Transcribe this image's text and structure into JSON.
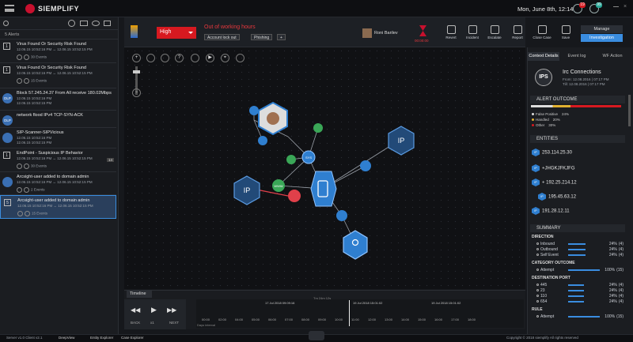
{
  "app": {
    "name": "SIEMPLIFY",
    "date": "Mon, June 8th, 12:14",
    "badge1": "19",
    "badge2": "99"
  },
  "colors": {
    "accent": "#3a8de0",
    "danger": "#d71920",
    "node": "#2f7fd0",
    "green": "#3aa757"
  },
  "left": {
    "alerts_count": "5 Alerts",
    "cases": [
      {
        "num": "1",
        "title": "Virus Found Or Security Risk Found",
        "sub1": "12.06.15 10:52:16 PM ↔ 12.06.15 10:52:15 PM",
        "sub2": "",
        "events": "30 Events"
      },
      {
        "num": "1",
        "title": "Virus Found Or Security Risk Found",
        "sub1": "12.06.15 10:52:16 PM ↔ 12.06.15 10:52:15 PM",
        "sub2": "",
        "events": "15 Events"
      },
      {
        "num": "DLP",
        "title": "Block 57.245.24.37 From All receive 180.02Mbps",
        "sub1": "12.06.15 10:52:16 PM",
        "sub2": "12.06.15 10:52:15 PM",
        "events": ""
      },
      {
        "num": "DLP",
        "title": "network flood IPv4 TCP-SYN-ACK",
        "sub1": "",
        "sub2": "",
        "events": ""
      },
      {
        "num": "",
        "title": "SIP-Scanner-SIPVicious",
        "sub1": "12.06.15 10:52:16 PM",
        "sub2": "12.06.15 10:52:15 PM",
        "events": ""
      },
      {
        "num": "1",
        "title": "EndPoint - Suspicious IP Behavior",
        "sub1": "12.06.15 10:52:16 PM ↔ 12.06.15 10:52:15 PM",
        "sub2": "",
        "events": "30 Events",
        "count": "14"
      },
      {
        "num": "",
        "title": "Arcsight-user added to domain admin",
        "sub1": "12.06.15 10:52:16 PM ↔ 12.06.15 10:52:15 PM",
        "sub2": "",
        "events": "2 Events"
      },
      {
        "num": "5",
        "title": "Arcsight-user added to domain admin",
        "sub1": "12.06.15 10:52:16 PM ↔ 12.06.15 10:52:15 PM",
        "sub2": "",
        "events": "15 Events"
      }
    ]
  },
  "header": {
    "priority": "High",
    "working_hours": "Out of working hours",
    "tags": [
      "Account lock out",
      "Phishing",
      "+"
    ],
    "analyst": "Roni Barilev",
    "sla": "00:00:00",
    "actions": [
      "Revert",
      "Incident",
      "Escalate",
      "Report",
      "Close Case",
      "Save"
    ],
    "manage": "Manage",
    "investigation": "Investigation"
  },
  "graph": {
    "nodes": {
      "ip1": "IP",
      "ip2": "IP",
      "hub": "SYS",
      "www": "WWW"
    },
    "tools": [
      "+",
      "?",
      "▶",
      "⌖"
    ]
  },
  "timeline": {
    "tab": "Timeline",
    "back": "BACK",
    "next": "NEXT",
    "speed": "x1",
    "label_a": "17 Jul 2018 09:09:16",
    "label_b": "19 Jul 2018 15:01:02",
    "label_c": "19 Jul 2018 15:01:02",
    "center_label": "Tm 24m 12s",
    "ticks": [
      "00:00",
      "02:00",
      "04:00",
      "05:00",
      "06:00",
      "07:00",
      "08:00",
      "09:00",
      "10:00",
      "11:00",
      "12:00",
      "13:00",
      "14:00",
      "15:00",
      "16:00",
      "17:00",
      "18:00"
    ],
    "days": "Days interval"
  },
  "right": {
    "tabs": [
      "Context Details",
      "Event log",
      "WF Action"
    ],
    "alert_icon": "IPS",
    "alert_title": "Irc Connections",
    "alert_from": "From: 12.08.2016 | 07:17 PM",
    "alert_to": "Till: 12.08.2016 | 07:17 PM",
    "outcome_title": "ALERT OUTCOME",
    "outcomes": [
      {
        "label": "False Positive",
        "value": "24%"
      },
      {
        "label": "Handled",
        "value": "20%"
      },
      {
        "label": "Other",
        "value": "30%"
      }
    ],
    "entities_title": "ENTITIES",
    "entities": [
      {
        "tag": "IP",
        "value": "253.114.25.30"
      },
      {
        "tag": "IP",
        "value": "+JHGKJFKJFG"
      },
      {
        "tag": "IP",
        "value": "+ 192.25.214.12"
      },
      {
        "tag": "IP",
        "value": "195.45.63.12"
      },
      {
        "tag": "IP",
        "value": "191.28.12.11"
      }
    ],
    "summary_title": "SUMMARY",
    "direction_title": "DIRECTION",
    "direction": [
      {
        "label": "Inbound",
        "value": "24%",
        "count": "(4)",
        "fill": 0.55
      },
      {
        "label": "Outbound",
        "value": "24%",
        "count": "(4)",
        "fill": 0.55
      },
      {
        "label": "Self Event",
        "value": "24%",
        "count": "(4)",
        "fill": 0.55
      }
    ],
    "category_title": "CATEGORY OUTCOME",
    "category": [
      {
        "label": "Attempt",
        "value": "100%",
        "count": "(15)",
        "fill": 1.0
      }
    ],
    "port_title": "DESTINATION PORT",
    "ports": [
      {
        "label": "445",
        "value": "24%",
        "count": "(4)",
        "fill": 0.5
      },
      {
        "label": "23",
        "value": "24%",
        "count": "(4)",
        "fill": 0.5
      },
      {
        "label": "110",
        "value": "24%",
        "count": "(4)",
        "fill": 0.5
      },
      {
        "label": "654",
        "value": "24%",
        "count": "(4)",
        "fill": 0.5
      }
    ],
    "rule_title": "RULE",
    "rules": [
      {
        "label": "Attempt",
        "value": "100%",
        "count": "(15)",
        "fill": 1.0
      }
    ]
  },
  "status": {
    "version": "Server v1.0  Client v2.1",
    "tabs": [
      "DeepView",
      "Entity Explorer",
      "Case Explorer"
    ],
    "copyright": "Copyright © 2018 siemplify All rights reserved"
  }
}
